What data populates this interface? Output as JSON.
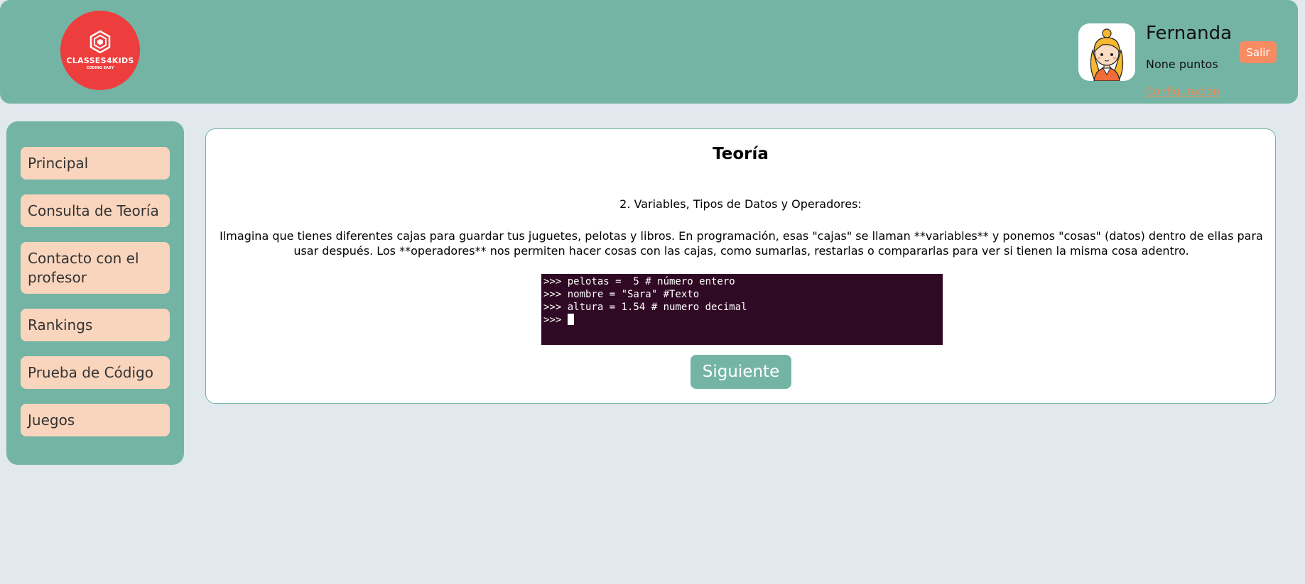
{
  "header": {
    "logo": {
      "text": "CLASSES4KIDS",
      "tagline": "CODING EASY"
    },
    "user": {
      "name": "Fernanda",
      "points": "None puntos",
      "config_link": "Configuración",
      "avatar_icon": "girl-avatar-icon"
    },
    "logout_label": "Salir"
  },
  "sidebar": {
    "items": [
      {
        "label": "Principal"
      },
      {
        "label": "Consulta de Teoría"
      },
      {
        "label": "Contacto con el profesor"
      },
      {
        "label": "Rankings"
      },
      {
        "label": "Prueba de Código"
      },
      {
        "label": "Juegos"
      }
    ]
  },
  "main": {
    "title": "Teoría",
    "subtitle": "2. Variables, Tipos de Datos y Operadores:",
    "paragraph": "Ilmagina que tienes diferentes cajas para guardar tus juguetes, pelotas y libros. En programación, esas \"cajas\" se llaman **variables** y ponemos \"cosas\" (datos) dentro de ellas para usar después. Los **operadores** nos permiten hacer cosas con las cajas, como sumarlas, restarlas o compararlas para ver si tienen la misma cosa adentro.",
    "terminal": {
      "lines": [
        ">>> pelotas =  5 # número entero",
        ">>> nombre = \"Sara\" #Texto",
        ">>> altura = 1.54 # numero decimal"
      ],
      "prompt": ">>> "
    },
    "next_label": "Siguiente"
  },
  "colors": {
    "teal": "#74b4a5",
    "peach": "#f9d5bd",
    "logo_red": "#ee3d3d",
    "logout_orange": "#f78c63",
    "terminal_bg": "#300a24",
    "page_bg": "#e1e8ee"
  }
}
